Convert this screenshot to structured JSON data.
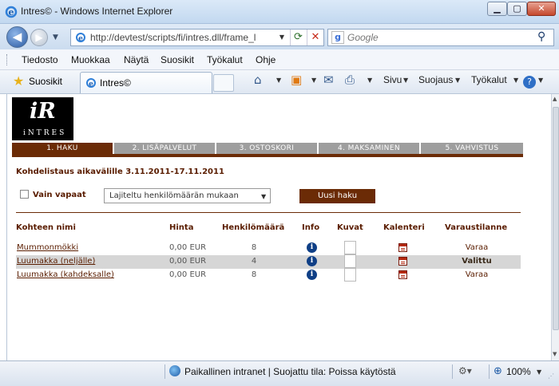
{
  "window": {
    "title": "Intres© - Windows Internet Explorer"
  },
  "window_buttons": {
    "minimize": "▁",
    "maximize": "▢",
    "close": "✕"
  },
  "address_bar": {
    "url": "http://devtest/scripts/fi/intres.dll/frame_l"
  },
  "search": {
    "placeholder": "Google",
    "engine_letter": "g"
  },
  "menu": [
    "Tiedosto",
    "Muokkaa",
    "Näytä",
    "Suosikit",
    "Työkalut",
    "Ohje"
  ],
  "favorites_bar": {
    "favorites_label": "Suosikit",
    "tab_title": "Intres©"
  },
  "command_bar": {
    "page_label": "Sivu",
    "safety_label": "Suojaus",
    "tools_label": "Työkalut"
  },
  "logo": {
    "mark": "iR",
    "word": "iNTRES"
  },
  "steps": [
    "1. HAKU",
    "2. LISÄPALVELUT",
    "3. OSTOSKORI",
    "4. MAKSAMINEN",
    "5. VAHVISTUS"
  ],
  "active_step": 0,
  "search_form": {
    "range_text": "Kohdelistaus aikavälille 3.11.2011-17.11.2011",
    "only_free_label": "Vain vapaat",
    "sort_selected": "Lajiteltu henkilömäärän mukaan",
    "new_search_button": "Uusi haku"
  },
  "table": {
    "headers": [
      "Kohteen nimi",
      "Hinta",
      "Henkilömäärä",
      "Info",
      "Kuvat",
      "Kalenteri",
      "Varaustilanne"
    ],
    "rows": [
      {
        "name": "Mummonmökki",
        "price": "0,00 EUR",
        "persons": "8",
        "status": "Varaa",
        "selected": false
      },
      {
        "name": "Luumakka (neljälle)",
        "price": "0,00 EUR",
        "persons": "4",
        "status": "Valittu",
        "selected": true
      },
      {
        "name": "Luumakka (kahdeksalle)",
        "price": "0,00 EUR",
        "persons": "8",
        "status": "Varaa",
        "selected": false
      }
    ]
  },
  "status_bar": {
    "zone": "Paikallinen intranet | Suojattu tila: Poissa käytöstä",
    "zoom": "100%"
  },
  "colors": {
    "brand_brown": "#6b2b06",
    "tab_inactive": "#9e9e9e",
    "info_blue": "#0f3f86"
  }
}
